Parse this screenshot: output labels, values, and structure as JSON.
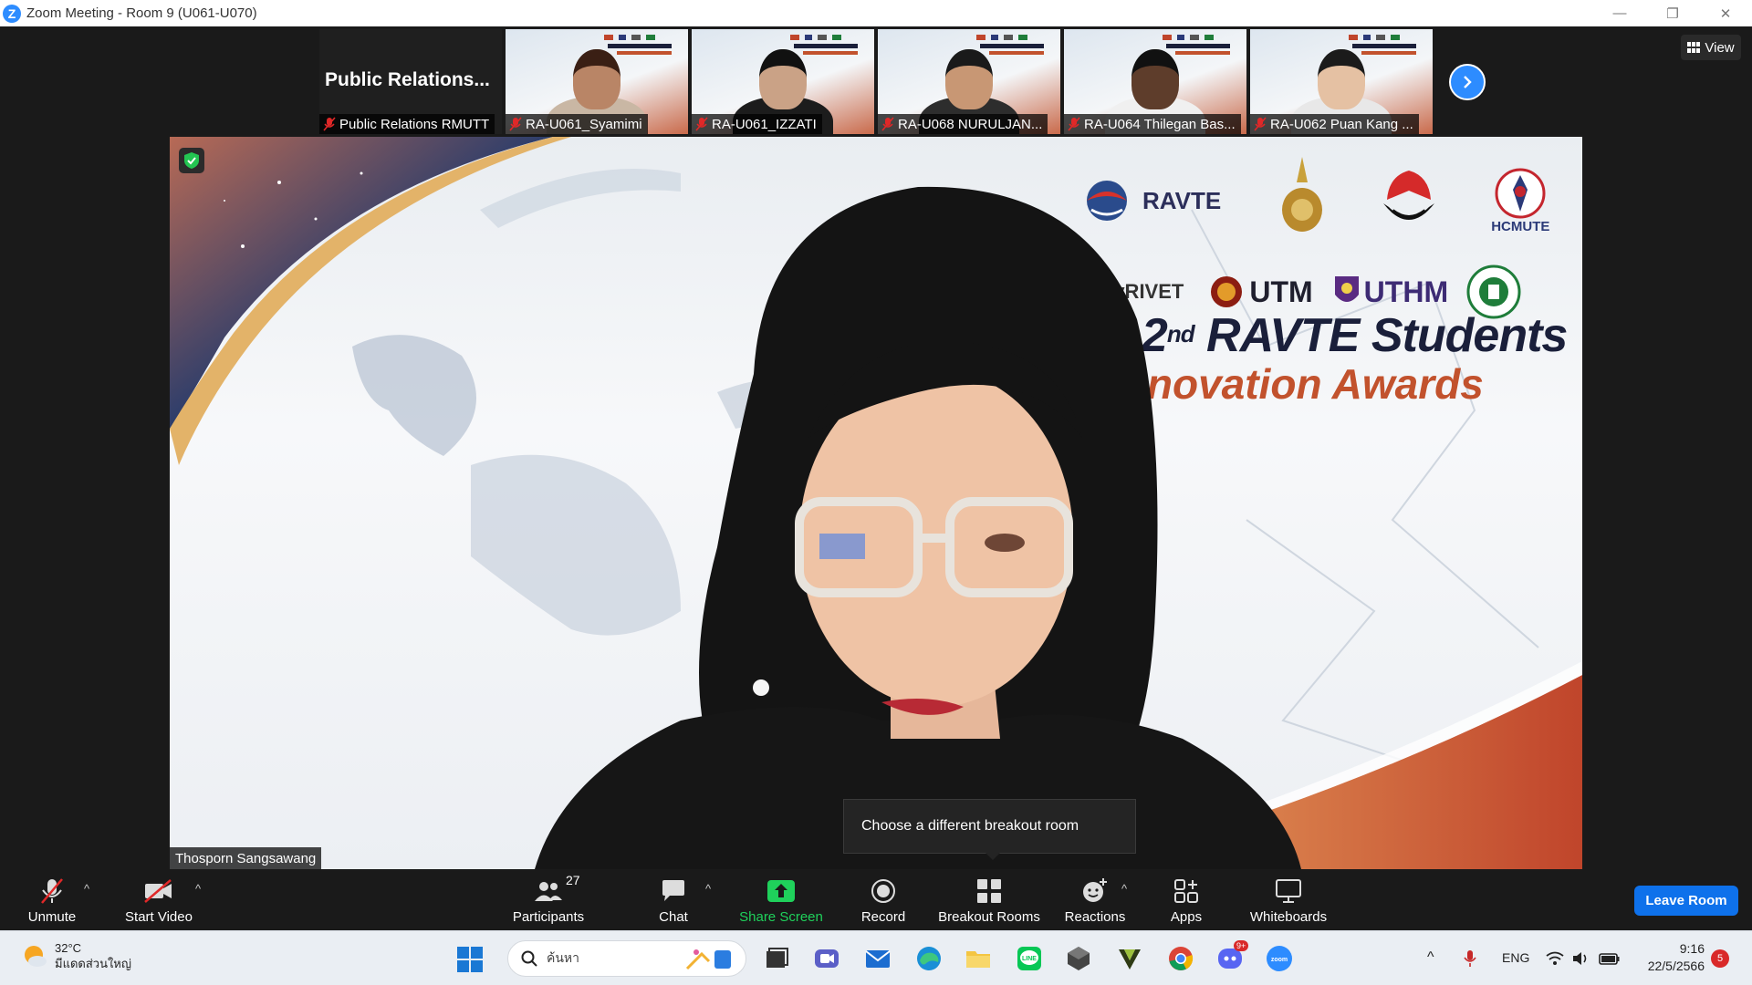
{
  "window": {
    "title": "Zoom Meeting - Room 9 (U061-U070)",
    "app_logo": "Z",
    "controls": {
      "minimize": "—",
      "restore": "❐",
      "close": "✕"
    }
  },
  "thumbnails": {
    "pr_tile": {
      "display_title": "Public  Relations...",
      "name": "Public Relations RMUTT"
    },
    "participants": [
      {
        "name": "RA-U061_Syamimi",
        "skin": "#b98566",
        "hair": "#3a1f14",
        "shirt": "#c9b7a4"
      },
      {
        "name": "RA-U061_IZZATI",
        "skin": "#caa286",
        "hair": "#111111",
        "shirt": "#1c1c1c"
      },
      {
        "name": "RA-U068 NURULJAN...",
        "skin": "#c89774",
        "hair": "#1a1a1a",
        "shirt": "#2d2d2d"
      },
      {
        "name": "RA-U064 Thilegan Bas...",
        "skin": "#5e3d2b",
        "hair": "#111111",
        "shirt": "#f0f0f0"
      },
      {
        "name": "RA-U062 Puan Kang ...",
        "skin": "#e5c1a3",
        "hair": "#1b1b1b",
        "shirt": "#e8e8e8"
      }
    ],
    "view_label": "View"
  },
  "main_video": {
    "speaker_name": "Thosporn Sangsawang",
    "event_title_line1": "The 2",
    "event_title_sup": "nd",
    "event_title_line1b": " RAVTE Students",
    "event_title_line2": "Innovation Awards",
    "logos_row1": [
      "RAVTE",
      "HCMUTE"
    ],
    "logos_row2": [
      "MyRIVET",
      "UTM",
      "UTHM"
    ]
  },
  "tooltip": {
    "text": "Choose a different breakout room"
  },
  "toolbar": {
    "unmute": "Unmute",
    "start_video": "Start Video",
    "participants": "Participants",
    "participant_count": "27",
    "chat": "Chat",
    "share_screen": "Share Screen",
    "record": "Record",
    "breakout_rooms": "Breakout Rooms",
    "reactions": "Reactions",
    "apps": "Apps",
    "whiteboards": "Whiteboards",
    "leave_room": "Leave Room",
    "caret": "^"
  },
  "taskbar": {
    "weather_temp": "32°C",
    "weather_desc": "มีแดดส่วนใหญ่",
    "search_placeholder": "ค้นหา",
    "language": "ENG",
    "time": "9:16",
    "date": "22/5/2566",
    "notification_count": "5",
    "discord_badge": "9+",
    "tray_caret": "^"
  },
  "colors": {
    "zoom_blue": "#2d8cff",
    "leave_blue": "#0e71eb",
    "share_green": "#1fd15b",
    "muted_red": "#e02828",
    "title_navy": "#1a1f3a",
    "title_orange": "#c2522d"
  }
}
